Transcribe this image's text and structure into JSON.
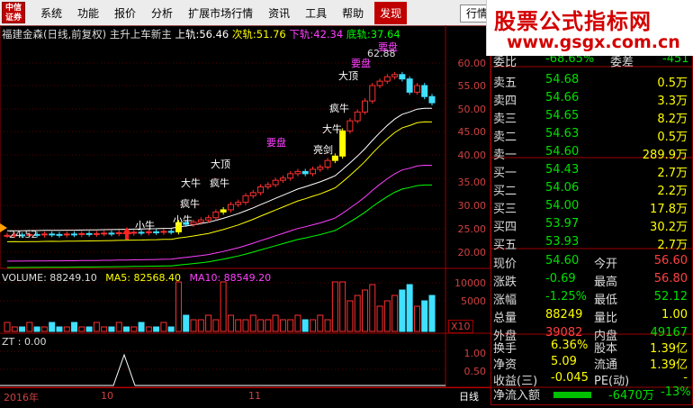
{
  "menubar": {
    "logo_text": "中信证券",
    "items": [
      "系统",
      "功能",
      "报价",
      "分析",
      "扩展市场行情",
      "资讯",
      "工具",
      "帮助"
    ],
    "highlight_item": "发现",
    "right_button": "行情"
  },
  "watermark": {
    "title": "股票公式指标网",
    "url": "www.gsgx.com.cn"
  },
  "chart": {
    "stock_title": "福建金森(日线,前复权) 主升上车新主",
    "upper_label": "上轨:",
    "upper_value": "56.46",
    "mid_label": "次轨:",
    "mid_value": "51.76",
    "lower_label": "下轨:",
    "lower_value": "42.34",
    "bottom_label": "底轨:",
    "bottom_value": "37.64",
    "y_ticks": [
      "60.00",
      "55.00",
      "50.00",
      "45.00",
      "40.00",
      "35.00",
      "30.00",
      "25.00",
      "20.00"
    ],
    "low_mark": "24.52",
    "high_mark": "62.88",
    "volume_label": "VOLUME: 88249.10",
    "ma5_label": "MA5: 82568.40",
    "ma10_label": "MA10: 88549.20",
    "vol_ticks": [
      "10000",
      "5000"
    ],
    "vol_unit": "X10",
    "zt_label": "ZT : 0.00",
    "zt_ticks": [
      "1.00",
      "0.50"
    ],
    "dates": [
      "2016年",
      "10",
      "11"
    ],
    "period": "日线",
    "annotations": [
      "小牛",
      "小牛",
      "疯牛",
      "大牛",
      "疯牛",
      "大顶",
      "要盘",
      "亮剑",
      "大牛",
      "疯牛",
      "大顶",
      "要盘",
      "要盘"
    ]
  },
  "quote": {
    "weibi_label": "委比",
    "weibi_value": "-68.65%",
    "weicha_label": "委差",
    "weicha_value": "-451",
    "sell": [
      {
        "label": "卖五",
        "price": "54.68",
        "vol": "0.5万"
      },
      {
        "label": "卖四",
        "price": "54.66",
        "vol": "3.3万"
      },
      {
        "label": "卖三",
        "price": "54.65",
        "vol": "8.2万"
      },
      {
        "label": "卖二",
        "price": "54.63",
        "vol": "0.5万"
      },
      {
        "label": "卖一",
        "price": "54.60",
        "vol": "289.9万"
      }
    ],
    "buy": [
      {
        "label": "买一",
        "price": "54.43",
        "vol": "2.7万"
      },
      {
        "label": "买二",
        "price": "54.06",
        "vol": "2.2万"
      },
      {
        "label": "买三",
        "price": "54.00",
        "vol": "17.8万"
      },
      {
        "label": "买四",
        "price": "53.97",
        "vol": "30.2万"
      },
      {
        "label": "买五",
        "price": "53.93",
        "vol": "2.7万"
      }
    ],
    "stats": [
      {
        "l1": "现价",
        "v1": "54.60",
        "c1": "#00e000",
        "l2": "今开",
        "v2": "56.60",
        "c2": "#ff4040"
      },
      {
        "l1": "涨跌",
        "v1": "-0.69",
        "c1": "#00e000",
        "l2": "最高",
        "v2": "56.80",
        "c2": "#ff4040"
      },
      {
        "l1": "涨幅",
        "v1": "-1.25%",
        "c1": "#00e000",
        "l2": "最低",
        "v2": "52.12",
        "c2": "#00e000"
      },
      {
        "l1": "总量",
        "v1": "88249",
        "c1": "#ffff00",
        "l2": "量比",
        "v2": "1.00",
        "c2": "#ffff00"
      },
      {
        "l1": "外盘",
        "v1": "39082",
        "c1": "#ff4040",
        "l2": "内盘",
        "v2": "49167",
        "c2": "#00e000"
      }
    ],
    "stats2": [
      {
        "l1": "换手",
        "v1": "6.36%",
        "l2": "股本",
        "v2": "1.39亿"
      },
      {
        "l1": "净资",
        "v1": "5.09",
        "l2": "流通",
        "v2": "1.39亿"
      },
      {
        "l1": "收益(三)",
        "v1": "-0.045",
        "l2": "PE(动)",
        "v2": "-"
      }
    ],
    "flow_label": "净流入额",
    "flow_value": "-6470万",
    "flow_pct": "-13%"
  }
}
